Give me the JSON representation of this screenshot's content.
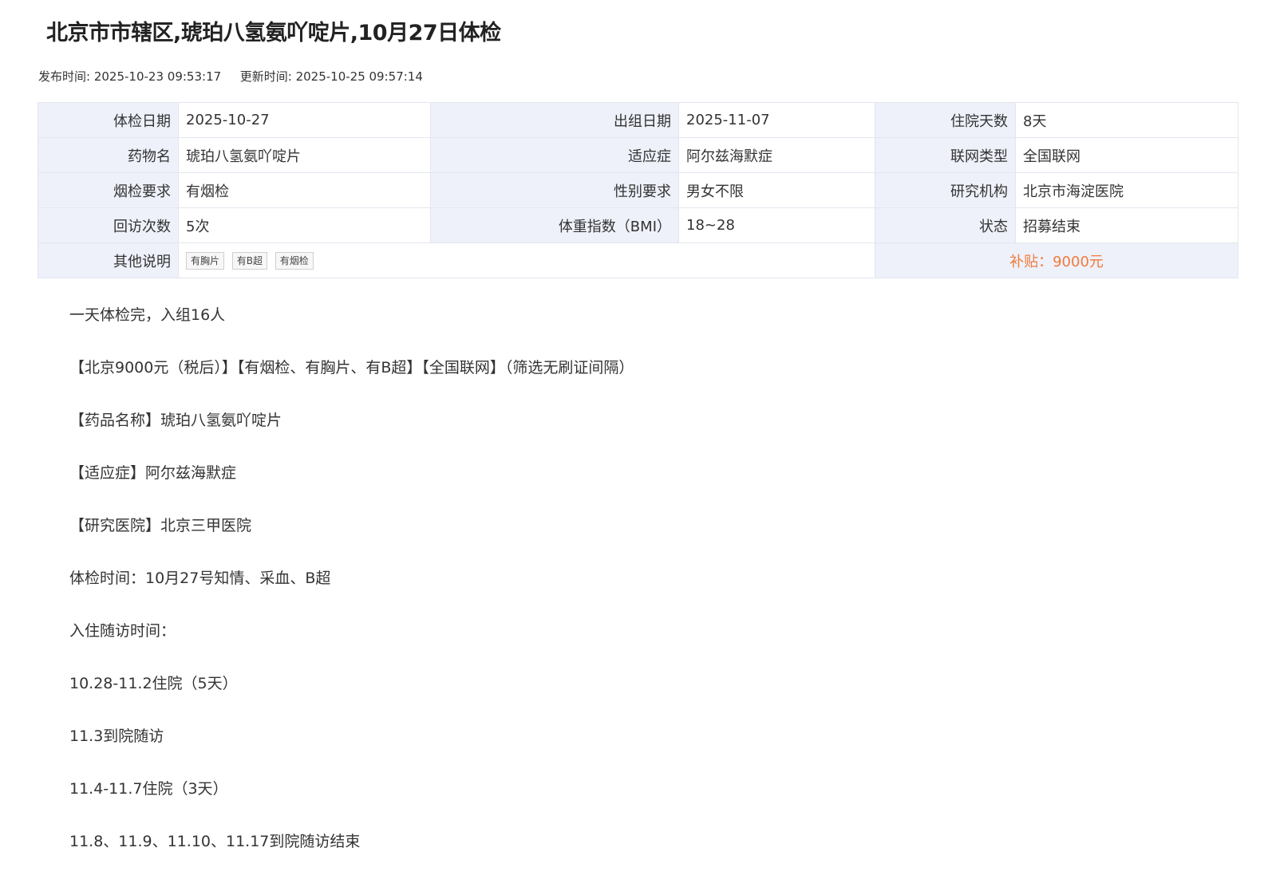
{
  "header": {
    "title": "北京市市辖区,琥珀八氢氨吖啶片,10月27日体检",
    "publish_label": "发布时间:",
    "publish_time": "2025-10-23 09:53:17",
    "update_label": "更新时间:",
    "update_time": "2025-10-25 09:57:14"
  },
  "info": {
    "rows": [
      [
        {
          "label": "体检日期",
          "value": "2025-10-27"
        },
        {
          "label": "出组日期",
          "value": "2025-11-07"
        },
        {
          "label": "住院天数",
          "value": "8天"
        }
      ],
      [
        {
          "label": "药物名",
          "value": "琥珀八氢氨吖啶片"
        },
        {
          "label": "适应症",
          "value": "阿尔兹海默症"
        },
        {
          "label": "联网类型",
          "value": "全国联网"
        }
      ],
      [
        {
          "label": "烟检要求",
          "value": "有烟检"
        },
        {
          "label": "性别要求",
          "value": "男女不限"
        },
        {
          "label": "研究机构",
          "value": "北京市海淀医院"
        }
      ],
      [
        {
          "label": "回访次数",
          "value": "5次"
        },
        {
          "label": "体重指数（BMI）",
          "value": "18~28"
        },
        {
          "label": "状态",
          "value": "招募结束"
        }
      ]
    ],
    "other_label": "其他说明",
    "tags": [
      "有胸片",
      "有B超",
      "有烟检"
    ],
    "subsidy": "补贴：9000元"
  },
  "colors": {
    "label_bg": "#eef1fa",
    "border": "#e3e6ee",
    "subsidy_text": "#f07a3a"
  },
  "content": {
    "paragraphs": [
      "一天体检完，入组16人",
      "【北京9000元（税后）】【有烟检、有胸片、有B超】【全国联网】（筛选无刷证间隔）",
      "【药品名称】琥珀八氢氨吖啶片",
      "【适应症】阿尔兹海默症",
      "【研究医院】北京三甲医院",
      "体检时间：10月27号知情、采血、B超",
      "入住随访时间：",
      "10.28-11.2住院（5天）",
      "11.3到院随访",
      "11.4-11.7住院（3天）",
      "11.8、11.9、11.10、11.17到院随访结束"
    ]
  }
}
